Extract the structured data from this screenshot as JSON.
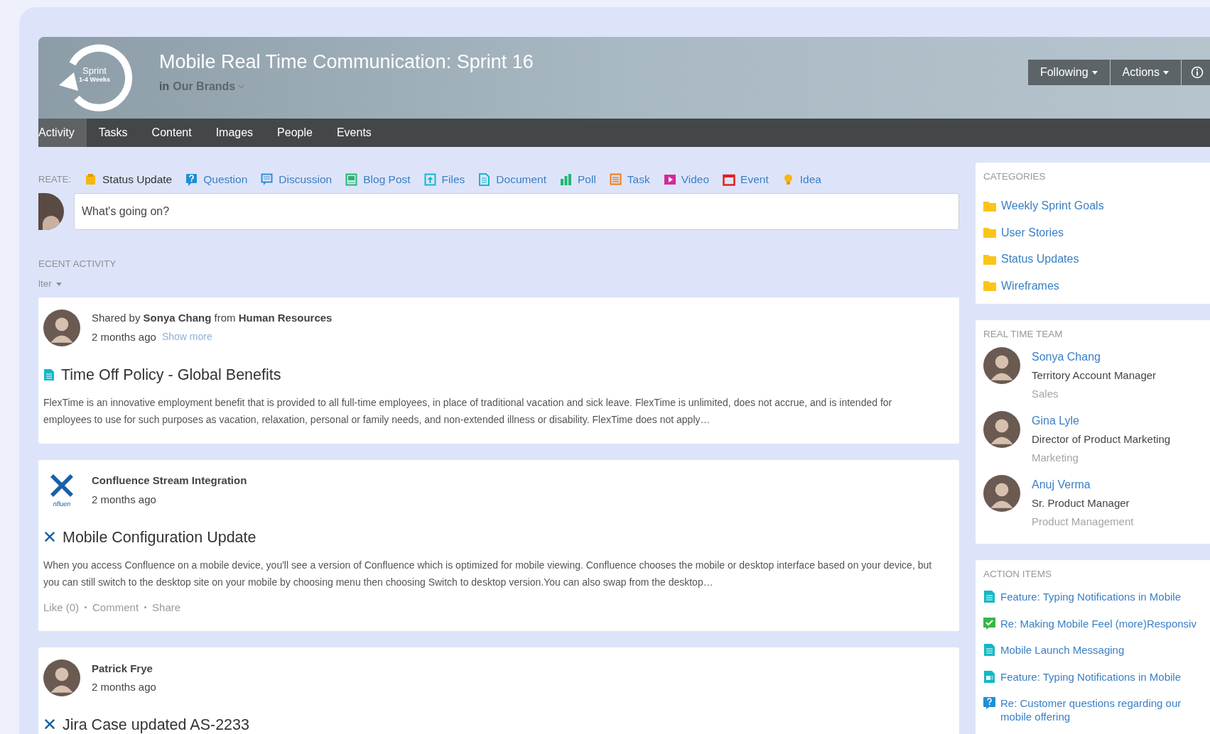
{
  "header": {
    "logo": {
      "title": "Sprint",
      "subtitle": "1-4 Weeks"
    },
    "title": "Mobile Real Time Communication: Sprint 16",
    "place_prefix": "in",
    "place": "Our Brands",
    "buttons": [
      {
        "label": "Following",
        "kind": "menu"
      },
      {
        "label": "Actions",
        "kind": "menu"
      },
      {
        "kind": "info"
      }
    ]
  },
  "tabs": [
    {
      "label": "Activity",
      "selected": true
    },
    {
      "label": "Tasks",
      "selected": false
    },
    {
      "label": "Content",
      "selected": false
    },
    {
      "label": "Images",
      "selected": false
    },
    {
      "label": "People",
      "selected": false
    },
    {
      "label": "Events",
      "selected": false
    }
  ],
  "create": {
    "label": "REATE:",
    "items": [
      {
        "label": "Status Update",
        "kind": "status",
        "selected": true
      },
      {
        "label": "Question",
        "kind": "question",
        "selected": false
      },
      {
        "label": "Discussion",
        "kind": "discussion",
        "selected": false
      },
      {
        "label": "Blog Post",
        "kind": "blog",
        "selected": false
      },
      {
        "label": "Files",
        "kind": "files",
        "selected": false
      },
      {
        "label": "Document",
        "kind": "document",
        "selected": false
      },
      {
        "label": "Poll",
        "kind": "poll",
        "selected": false
      },
      {
        "label": "Task",
        "kind": "task",
        "selected": false
      },
      {
        "label": "Video",
        "kind": "video",
        "selected": false
      },
      {
        "label": "Event",
        "kind": "event",
        "selected": false
      },
      {
        "label": "Idea",
        "kind": "idea",
        "selected": false
      }
    ]
  },
  "composer": {
    "placeholder": "What's going on?"
  },
  "recent_activity": {
    "heading": "ECENT ACTIVITY",
    "filter": "lter"
  },
  "feed": [
    {
      "kind": "shared-document",
      "byline": "Shared by **Sonya Chang** from **Human Resources**",
      "time": "2 months ago",
      "link": "Show more",
      "title": "Time Off Policy - Global Benefits",
      "body": "FlexTime is an innovative employment benefit that is provided to all full-time  employees, in place of traditional vacation and sick leave. FlexTime is unlimited, does not accrue, and is intended for employees to use for such purposes as vacation, relaxation, personal or family needs, and non-extended illness or disability. FlexTime does not apply…"
    },
    {
      "kind": "integration",
      "logo_text": "nfluen",
      "byline": "**Confluence Stream Integration**",
      "time": "2 months ago",
      "title": "Mobile Configuration Update",
      "body": "When you access Confluence on a mobile device, you'll see a version of Confluence which is optimized for mobile viewing. Confluence chooses the mobile or desktop interface based on your device, but you can still switch to the desktop site on your mobile by choosing menu  then choosing Switch to desktop version.You can also swap from the desktop…",
      "actions": [
        "Like (0)",
        "Comment",
        "Share"
      ]
    },
    {
      "kind": "person-update",
      "byline": "**Patrick Frye**",
      "time": "2 months ago",
      "title": "Jira Case updated AS-2233"
    }
  ],
  "categories": {
    "heading": "CATEGORIES",
    "items": [
      "Weekly Sprint Goals",
      "User Stories",
      "Status Updates",
      "Wireframes"
    ]
  },
  "team": {
    "heading": "REAL TIME TEAM",
    "members": [
      {
        "name": "Sonya Chang",
        "role": "Territory Account Manager",
        "department": "Sales"
      },
      {
        "name": "Gina Lyle",
        "role": "Director of Product Marketing",
        "department": "Marketing"
      },
      {
        "name": "Anuj Verma",
        "role": "Sr. Product Manager",
        "department": "Product Management"
      }
    ]
  },
  "action_items": {
    "heading": "ACTION ITEMS",
    "items": [
      {
        "label": "Feature: Typing Notifications in Mobile",
        "kind": "document"
      },
      {
        "label": "Re: Making Mobile Feel (more)Responsiv",
        "kind": "check"
      },
      {
        "label": "Mobile Launch Messaging",
        "kind": "document"
      },
      {
        "label": "Feature: Typing Notifications in Mobile",
        "kind": "image-doc"
      },
      {
        "label": "Re: Customer questions regarding our mobile offering",
        "kind": "question"
      }
    ]
  }
}
